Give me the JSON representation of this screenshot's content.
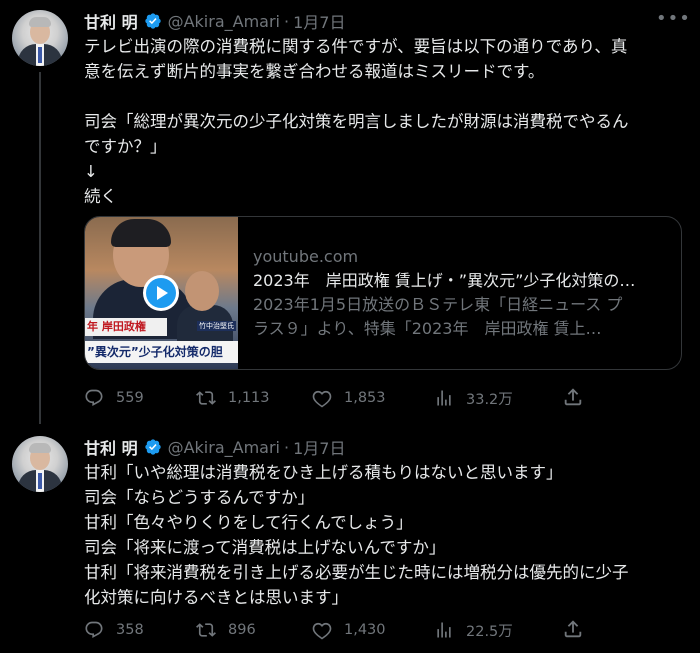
{
  "tweets": [
    {
      "author": {
        "name": "甘利 明",
        "handle": "@Akira_Amari",
        "separator": "·",
        "date": "1月7日"
      },
      "text": "テレビ出演の際の消費税に関する件ですが、要旨は以下の通りであり、真\n意を伝えず断片的事実を繋ぎ合わせる報道はミスリードです。\n\n司会「総理が異次元の少子化対策を明言しましたが財源は消費税でやるん\nですか？」\n↓\n続く",
      "card": {
        "domain": "youtube.com",
        "title": "2023年　岸田政権 賃上げ・”異次元”少子化対策の…",
        "description": "2023年1月5日放送のＢＳテレ東「日経ニュース プ\nラス９」より、特集「2023年　岸田政権 賃上…",
        "thumb_caption_1": "年 岸田政権",
        "thumb_caption_2": "”異次元”少子化対策の胆",
        "thumb_tag": "竹中治堅氏"
      },
      "stats": {
        "replies": "559",
        "retweets": "1,113",
        "likes": "1,853",
        "views": "33.2万"
      }
    },
    {
      "author": {
        "name": "甘利 明",
        "handle": "@Akira_Amari",
        "separator": "·",
        "date": "1月7日"
      },
      "text": "甘利「いや総理は消費税をひき上げる積もりはないと思います」\n司会「ならどうするんですか」\n甘利「色々やりくりをして行くんでしょう」\n司会「将来に渡って消費税は上げないんですか」\n甘利「将来消費税を引き上げる必要が生じた時には増税分は優先的に少子\n化対策に向けるべきとは思います」",
      "stats": {
        "replies": "358",
        "retweets": "896",
        "likes": "1,430",
        "views": "22.5万"
      }
    }
  ],
  "icons": {
    "verified": "verified-badge-icon",
    "more": "more-options-icon",
    "reply": "reply-icon",
    "retweet": "retweet-icon",
    "like": "heart-icon",
    "views": "views-chart-icon",
    "share": "share-icon",
    "play": "play-icon"
  },
  "colors": {
    "background": "#000000",
    "text": "#e7e9ea",
    "muted": "#71767b",
    "accent": "#1d9bf0",
    "border": "#333639"
  }
}
